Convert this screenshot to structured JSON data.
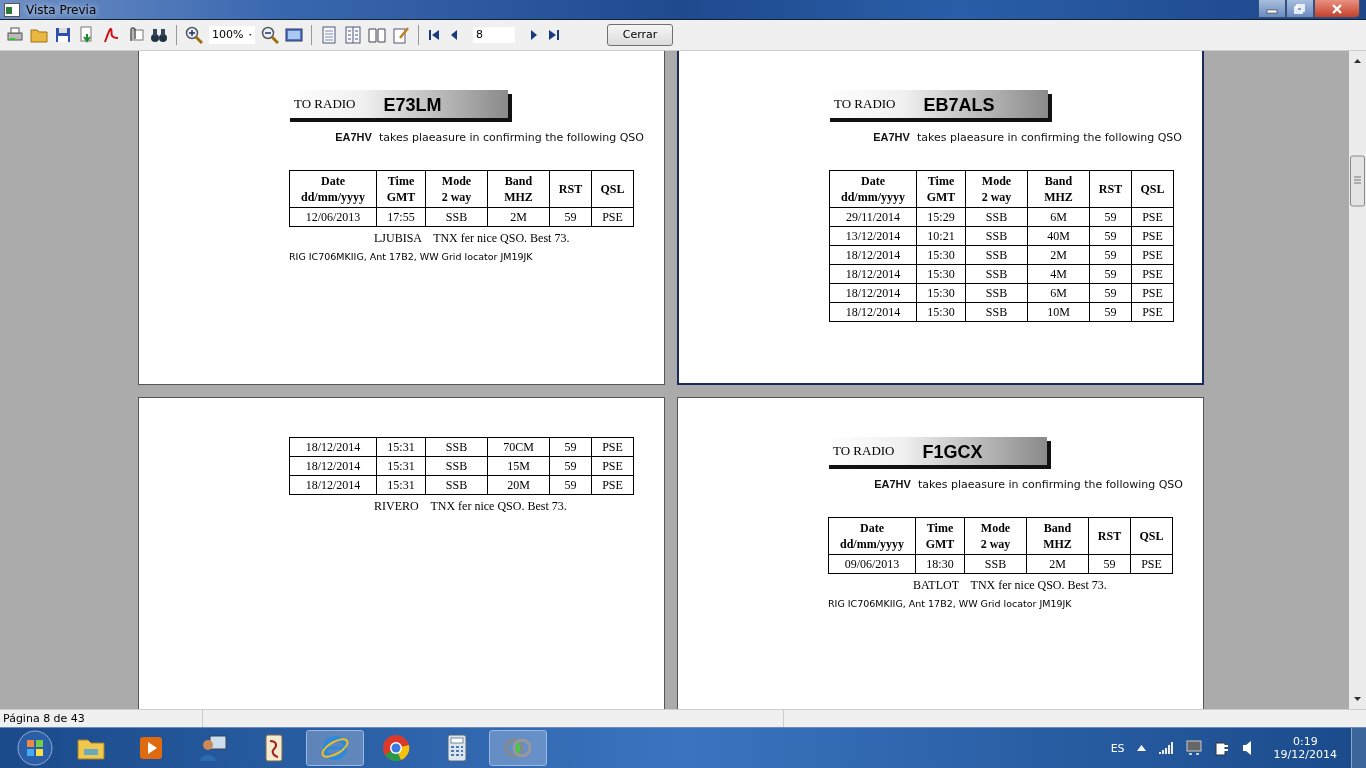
{
  "window": {
    "title": "Vista Previa"
  },
  "toolbar": {
    "zoom": "100%",
    "page": "8",
    "close_button": "Cerrar"
  },
  "pages": [
    {
      "selected": false,
      "header": {
        "label": "TO RADIO",
        "callsign": "E73LM"
      },
      "intro": "**EA7HV**  takes plaeasure in confirming the following QSO",
      "columns": [
        "Date\ndd/mm/yyyy",
        "Time\nGMT",
        "Mode\n2 way",
        "Band\nMHZ",
        "RST",
        "QSL"
      ],
      "rows": [
        [
          "12/06/2013",
          "17:55",
          "SSB",
          "2M",
          "59",
          "PSE"
        ]
      ],
      "closing": "LJUBISA    TNX fer nice QSO. Best 73.",
      "rig": "RIG IC706MKIIG, Ant 17B2, WW Grid locator JM19JK"
    },
    {
      "selected": true,
      "header": {
        "label": "TO RADIO",
        "callsign": "EB7ALS"
      },
      "intro": "**EA7HV**  takes plaeasure in confirming the following QSO",
      "columns": [
        "Date\ndd/mm/yyyy",
        "Time\nGMT",
        "Mode\n2 way",
        "Band\nMHZ",
        "RST",
        "QSL"
      ],
      "rows": [
        [
          "29/11/2014",
          "15:29",
          "SSB",
          "6M",
          "59",
          "PSE"
        ],
        [
          "13/12/2014",
          "10:21",
          "SSB",
          "40M",
          "59",
          "PSE"
        ],
        [
          "18/12/2014",
          "15:30",
          "SSB",
          "2M",
          "59",
          "PSE"
        ],
        [
          "18/12/2014",
          "15:30",
          "SSB",
          "4M",
          "59",
          "PSE"
        ],
        [
          "18/12/2014",
          "15:30",
          "SSB",
          "6M",
          "59",
          "PSE"
        ],
        [
          "18/12/2014",
          "15:30",
          "SSB",
          "10M",
          "59",
          "PSE"
        ]
      ]
    },
    {
      "selected": false,
      "rows": [
        [
          "18/12/2014",
          "15:31",
          "SSB",
          "70CM",
          "59",
          "PSE"
        ],
        [
          "18/12/2014",
          "15:31",
          "SSB",
          "15M",
          "59",
          "PSE"
        ],
        [
          "18/12/2014",
          "15:31",
          "SSB",
          "20M",
          "59",
          "PSE"
        ]
      ],
      "closing": "RIVERO    TNX fer nice QSO. Best 73."
    },
    {
      "selected": false,
      "header": {
        "label": "TO RADIO",
        "callsign": "F1GCX"
      },
      "intro": "**EA7HV**  takes plaeasure in confirming the following QSO",
      "columns": [
        "Date\ndd/mm/yyyy",
        "Time\nGMT",
        "Mode\n2 way",
        "Band\nMHZ",
        "RST",
        "QSL"
      ],
      "rows": [
        [
          "09/06/2013",
          "18:30",
          "SSB",
          "2M",
          "59",
          "PSE"
        ]
      ],
      "closing": "BATLOT    TNX fer nice QSO. Best 73.",
      "rig": "RIG IC706MKIIG, Ant 17B2, WW Grid locator JM19JK"
    }
  ],
  "status_bar": {
    "page_info": "Página 8 de 43"
  },
  "taskbar": {
    "apps": [
      {
        "kind": "explorer",
        "selected": false
      },
      {
        "kind": "media",
        "selected": false
      },
      {
        "kind": "remote",
        "selected": false
      },
      {
        "kind": "mahjong",
        "selected": false
      },
      {
        "kind": "browser",
        "selected": true
      },
      {
        "kind": "chrome",
        "selected": false
      },
      {
        "kind": "calculator",
        "selected": false
      },
      {
        "kind": "rings",
        "selected": true
      }
    ],
    "language": "ES",
    "time": "0:19",
    "date": "19/12/2014"
  }
}
